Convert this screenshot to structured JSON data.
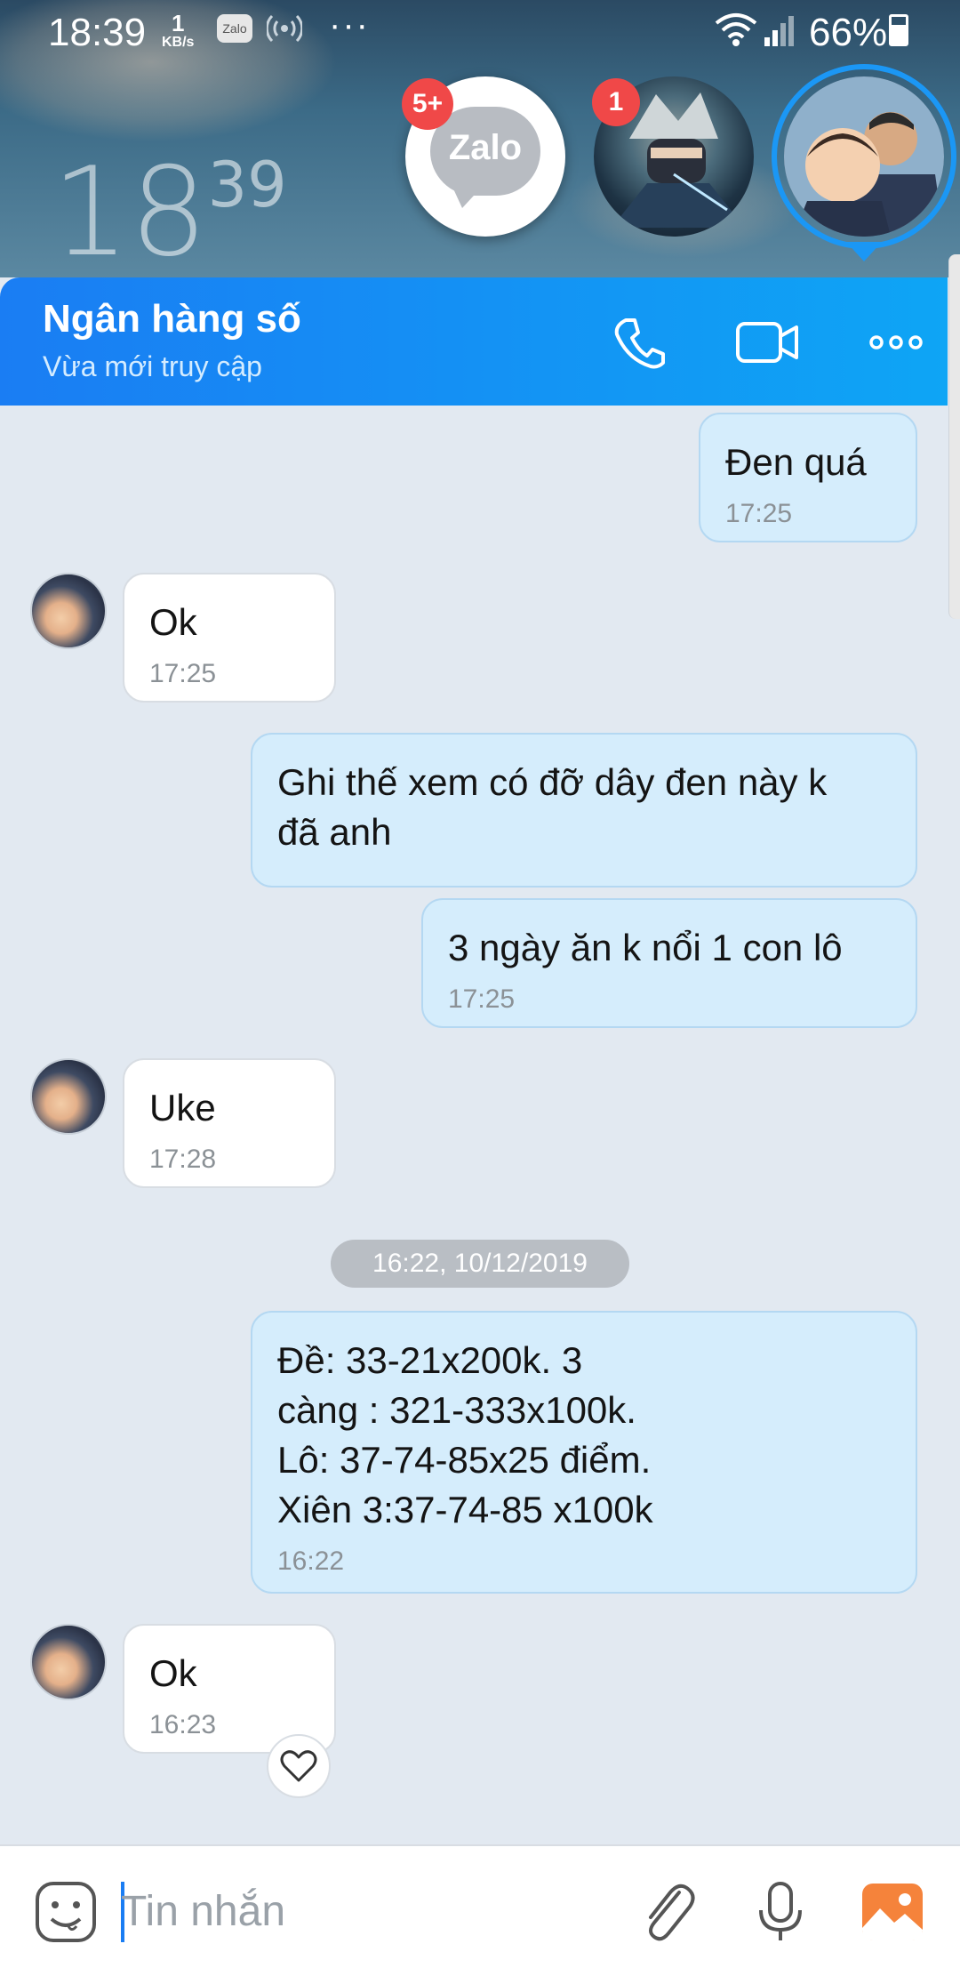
{
  "status_bar": {
    "time": "18:39",
    "speed_value": "1",
    "speed_unit": "KB/s",
    "zalo_icon_text": "Zalo",
    "more": "···",
    "battery": "66%"
  },
  "home_widget": {
    "clock_hours": "18",
    "clock_minutes": "39"
  },
  "chat_heads": [
    {
      "name": "Zalo",
      "badge": "5+"
    },
    {
      "name": "ninja",
      "badge": "1"
    },
    {
      "name": "active-contact",
      "badge": ""
    }
  ],
  "header": {
    "title": "Ngân hàng số",
    "subtitle": "Vừa mới truy cập"
  },
  "messages": [
    {
      "dir": "out",
      "text": "Đen quá",
      "time": "17:25"
    },
    {
      "dir": "in",
      "text": "Ok",
      "time": "17:25"
    },
    {
      "dir": "out",
      "text": "Ghi thế xem có đỡ dây đen này k\nđã anh",
      "time": ""
    },
    {
      "dir": "out",
      "text": "3 ngày ăn k nổi 1 con lô",
      "time": "17:25"
    },
    {
      "dir": "in",
      "text": "Uke",
      "time": "17:28"
    },
    {
      "dir": "out",
      "text": "Đề: 33-21x200k. 3\ncàng : 321-333x100k.\nLô: 37-74-85x25 điểm.\nXiên 3:37-74-85 x100k",
      "time": "16:22"
    },
    {
      "dir": "in",
      "text": "Ok",
      "time": "16:23"
    }
  ],
  "date_separator": "16:22, 10/12/2019",
  "input": {
    "placeholder": "Tin nhắn"
  },
  "colors": {
    "header_start": "#1a7df3",
    "header_end": "#0ea5f5",
    "outgoing_bubble": "#d5edfc",
    "incoming_bubble": "#ffffff",
    "chat_background": "#e2e9f1",
    "badge": "#f04848"
  },
  "icons": [
    "phone-icon",
    "video-call-icon",
    "more-options-icon",
    "emoji-icon",
    "attach-icon",
    "microphone-icon",
    "gallery-icon",
    "heart-icon"
  ]
}
